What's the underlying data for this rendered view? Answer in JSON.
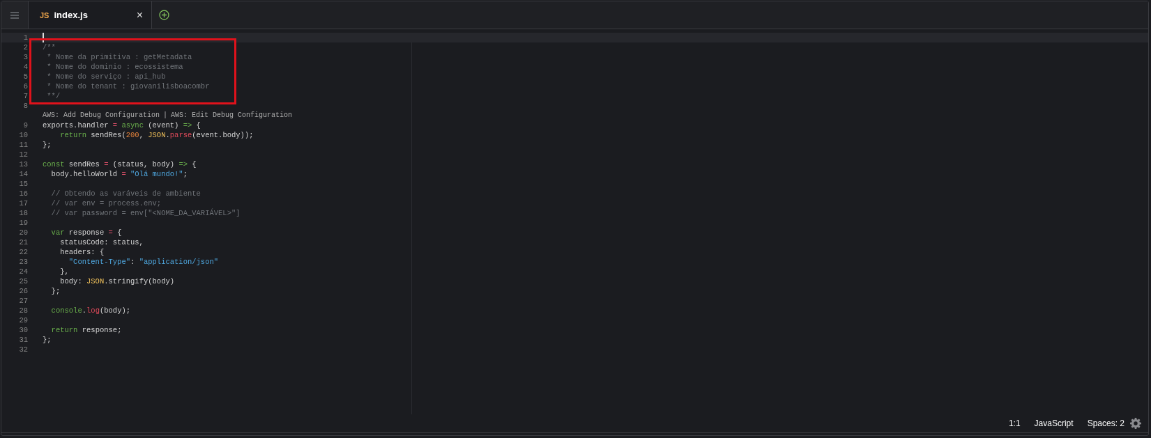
{
  "tabs": [
    {
      "badge": "JS",
      "label": "index.js",
      "close": "×",
      "selected": true
    }
  ],
  "code": {
    "blocks": [
      {
        "kind": "lines",
        "boxed": false,
        "lines": [
          {
            "number": "1",
            "current": true
          }
        ]
      },
      {
        "kind": "lines",
        "boxed": true,
        "lines": [
          {
            "number": "2",
            "current": false,
            "tokens": [
              {
                "kind": "comment",
                "text": "/**"
              }
            ]
          },
          {
            "number": "3",
            "current": false,
            "tokens": [
              {
                "kind": "comment",
                "text": " * Nome da primitiva : getMetadata"
              }
            ]
          },
          {
            "number": "4",
            "current": false,
            "tokens": [
              {
                "kind": "comment",
                "text": " * Nome do dominio : ecossistema"
              }
            ]
          },
          {
            "number": "5",
            "current": false,
            "tokens": [
              {
                "kind": "comment",
                "text": " * Nome do serviço : api_hub"
              }
            ]
          },
          {
            "number": "6",
            "current": false,
            "tokens": [
              {
                "kind": "comment",
                "text": " * Nome do tenant : giovanilisboacombr"
              }
            ]
          },
          {
            "number": "7",
            "current": false,
            "tokens": [
              {
                "kind": "comment",
                "text": " **/"
              }
            ]
          }
        ]
      },
      {
        "kind": "lines",
        "boxed": false,
        "lines": [
          {
            "number": "8",
            "current": false
          }
        ]
      },
      {
        "kind": "codelens",
        "links": [
          "AWS: Add Debug Configuration",
          "AWS: Edit Debug Configuration"
        ],
        "separator": "|"
      },
      {
        "kind": "lines",
        "boxed": false,
        "lines": [
          {
            "number": "9",
            "current": false,
            "tokens": [
              {
                "kind": "plain",
                "text": "exports.handler "
              },
              {
                "kind": "operator",
                "text": "="
              },
              {
                "kind": "keyword",
                "text": " async"
              },
              {
                "kind": "plain",
                "text": " (event) "
              },
              {
                "kind": "keyword",
                "text": "=>"
              },
              {
                "kind": "plain",
                "text": " {"
              }
            ]
          },
          {
            "number": "10",
            "current": false,
            "tokens": [
              {
                "kind": "keyword",
                "text": "    return"
              },
              {
                "kind": "plain",
                "text": " sendRes("
              },
              {
                "kind": "number",
                "text": "200"
              },
              {
                "kind": "plain",
                "text": ", "
              },
              {
                "kind": "class",
                "text": "JSON"
              },
              {
                "kind": "plain",
                "text": "."
              },
              {
                "kind": "function",
                "text": "parse"
              },
              {
                "kind": "plain",
                "text": "(event.body));"
              }
            ]
          },
          {
            "number": "11",
            "current": false,
            "tokens": [
              {
                "kind": "plain",
                "text": "};"
              }
            ]
          },
          {
            "number": "12",
            "current": false
          },
          {
            "number": "13",
            "current": false,
            "tokens": [
              {
                "kind": "keyword",
                "text": "const"
              },
              {
                "kind": "plain",
                "text": " sendRes "
              },
              {
                "kind": "operator",
                "text": "="
              },
              {
                "kind": "plain",
                "text": " (status, body) "
              },
              {
                "kind": "keyword",
                "text": "=>"
              },
              {
                "kind": "plain",
                "text": " {"
              }
            ]
          },
          {
            "number": "14",
            "current": false,
            "tokens": [
              {
                "kind": "plain",
                "text": "  body.helloWorld "
              },
              {
                "kind": "operator",
                "text": "="
              },
              {
                "kind": "string",
                "text": " \"Olá mundo!\""
              },
              {
                "kind": "plain",
                "text": ";"
              }
            ]
          },
          {
            "number": "15",
            "current": false
          },
          {
            "number": "16",
            "current": false,
            "tokens": [
              {
                "kind": "comment",
                "text": "  // Obtendo as varáveis de ambiente"
              }
            ]
          },
          {
            "number": "17",
            "current": false,
            "tokens": [
              {
                "kind": "comment",
                "text": "  // var env = process.env;"
              }
            ]
          },
          {
            "number": "18",
            "current": false,
            "tokens": [
              {
                "kind": "comment",
                "text": "  // var password = env[\"<NOME_DA_VARIÁVEL>\"]"
              }
            ]
          },
          {
            "number": "19",
            "current": false
          },
          {
            "number": "20",
            "current": false,
            "tokens": [
              {
                "kind": "keyword",
                "text": "  var"
              },
              {
                "kind": "plain",
                "text": " response "
              },
              {
                "kind": "operator",
                "text": "="
              },
              {
                "kind": "plain",
                "text": " {"
              }
            ]
          },
          {
            "number": "21",
            "current": false,
            "tokens": [
              {
                "kind": "plain",
                "text": "    statusCode: status,"
              }
            ]
          },
          {
            "number": "22",
            "current": false,
            "tokens": [
              {
                "kind": "plain",
                "text": "    headers: {"
              }
            ]
          },
          {
            "number": "23",
            "current": false,
            "tokens": [
              {
                "kind": "string",
                "text": "      \"Content-Type\""
              },
              {
                "kind": "plain",
                "text": ": "
              },
              {
                "kind": "string",
                "text": "\"application/json\""
              }
            ]
          },
          {
            "number": "24",
            "current": false,
            "tokens": [
              {
                "kind": "plain",
                "text": "    },"
              }
            ]
          },
          {
            "number": "25",
            "current": false,
            "tokens": [
              {
                "kind": "plain",
                "text": "    body: "
              },
              {
                "kind": "class",
                "text": "JSON"
              },
              {
                "kind": "plain",
                "text": ".stringify(body)"
              }
            ]
          },
          {
            "number": "26",
            "current": false,
            "tokens": [
              {
                "kind": "plain",
                "text": "  };"
              }
            ]
          },
          {
            "number": "27",
            "current": false
          },
          {
            "number": "28",
            "current": false,
            "tokens": [
              {
                "kind": "keyword",
                "text": "  console"
              },
              {
                "kind": "plain",
                "text": "."
              },
              {
                "kind": "function",
                "text": "log"
              },
              {
                "kind": "plain",
                "text": "(body);"
              }
            ]
          },
          {
            "number": "29",
            "current": false
          },
          {
            "number": "30",
            "current": false,
            "tokens": [
              {
                "kind": "keyword",
                "text": "  return"
              },
              {
                "kind": "plain",
                "text": " response;"
              }
            ]
          },
          {
            "number": "31",
            "current": false,
            "tokens": [
              {
                "kind": "plain",
                "text": "};"
              }
            ]
          },
          {
            "number": "32",
            "current": false
          }
        ]
      }
    ]
  },
  "status_bar": {
    "position": "1:1",
    "language": "JavaScript",
    "indent": "Spaces: 2"
  }
}
